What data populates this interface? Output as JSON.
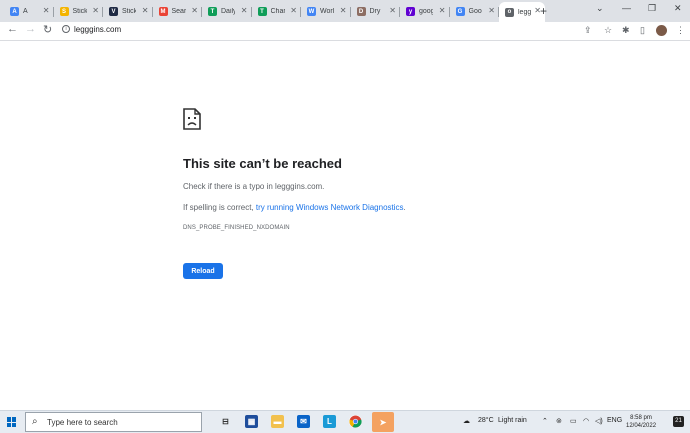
{
  "tabs": [
    {
      "label": "A",
      "fav_color": "#4285f4",
      "fav_glyph": "A",
      "active": false
    },
    {
      "label": "Stick",
      "fav_color": "#f4b400",
      "fav_glyph": "S",
      "active": false
    },
    {
      "label": "Stick",
      "fav_color": "#1f2a44",
      "fav_glyph": "V",
      "active": false
    },
    {
      "label": "Sear",
      "fav_color": "#ea4335",
      "fav_glyph": "M",
      "active": false
    },
    {
      "label": "Daily",
      "fav_color": "#0f9d58",
      "fav_glyph": "T",
      "active": false
    },
    {
      "label": "Char",
      "fav_color": "#0f9d58",
      "fav_glyph": "T",
      "active": false
    },
    {
      "label": "Worl",
      "fav_color": "#4285f4",
      "fav_glyph": "W",
      "active": false
    },
    {
      "label": "Dry",
      "fav_color": "#8d6e63",
      "fav_glyph": "D",
      "active": false
    },
    {
      "label": "goog",
      "fav_color": "#6001d2",
      "fav_glyph": "y",
      "active": false
    },
    {
      "label": "Goo",
      "fav_color": "#4285f4",
      "fav_glyph": "G",
      "active": false
    },
    {
      "label": "legg",
      "fav_color": "#5f6368",
      "fav_glyph": "o",
      "active": true
    }
  ],
  "address_bar": {
    "url": "legggins.com"
  },
  "error": {
    "title": "This site can’t be reached",
    "line1": "Check if there is a typo in legggins.com.",
    "line2_prefix": "If spelling is correct, ",
    "line2_link": "try running Windows Network Diagnostics",
    "line2_suffix": ".",
    "code": "DNS_PROBE_FINISHED_NXDOMAIN",
    "reload_label": "Reload"
  },
  "taskbar": {
    "search_placeholder": "Type here to search",
    "weather_temp": "28°C",
    "weather_desc": "Light rain",
    "language": "ENG",
    "time": "8:58 pm",
    "date": "12/04/2022",
    "notification_count": "21"
  },
  "colors": {
    "accent": "#1a73e8",
    "tabstrip": "#dee1e6",
    "taskbar": "#e7ecf2"
  }
}
